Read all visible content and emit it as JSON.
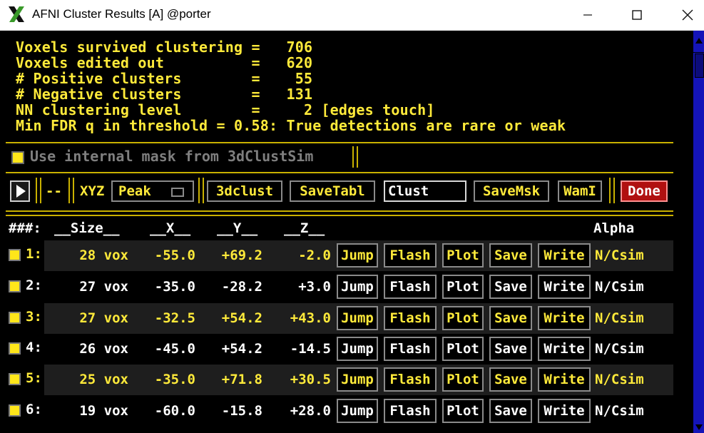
{
  "window": {
    "title": "AFNI Cluster Results [A] @porter",
    "controls": {
      "minimize": "─",
      "maximize": "☐",
      "close": "✕"
    }
  },
  "summary": [
    "Voxels survived clustering =   706",
    "Voxels edited out          =   620",
    "# Positive clusters        =    55",
    "# Negative clusters        =   131",
    "NN clustering level        =     2 [edges touch]",
    "Min FDR q in threshold = 0.58: True detections are rare or weak"
  ],
  "mask_option": {
    "label": "Use internal mask from 3dClustSim",
    "checked": true
  },
  "toolbar": {
    "play": "▶",
    "dashes": "--",
    "coord_label": "XYZ",
    "peak_label": "Peak",
    "clust_button": "3dclust",
    "savetabl_button": "SaveTabl",
    "prefix_value": "Clust",
    "savemsk_button": "SaveMsk",
    "wami_button": "WamI",
    "done_button": "Done"
  },
  "columns": {
    "index": "###:",
    "size": "__Size__",
    "x": "__X__",
    "y": "__Y__",
    "z": "__Z__",
    "alpha": "Alpha"
  },
  "row_buttons": {
    "jump": "Jump",
    "flash": "Flash",
    "plot": "Plot",
    "save": "Save",
    "write": "Write"
  },
  "clusters": [
    {
      "num": "1:",
      "size": "28 vox",
      "x": "-55.0",
      "y": "+69.2",
      "z": "-2.0",
      "alpha": "N/Csim",
      "color": "yellow"
    },
    {
      "num": "2:",
      "size": "27 vox",
      "x": "-35.0",
      "y": "-28.2",
      "z": "+3.0",
      "alpha": "N/Csim",
      "color": "white"
    },
    {
      "num": "3:",
      "size": "27 vox",
      "x": "-32.5",
      "y": "+54.2",
      "z": "+43.0",
      "alpha": "N/Csim",
      "color": "yellow"
    },
    {
      "num": "4:",
      "size": "26 vox",
      "x": "-45.0",
      "y": "+54.2",
      "z": "-14.5",
      "alpha": "N/Csim",
      "color": "white"
    },
    {
      "num": "5:",
      "size": "25 vox",
      "x": "-35.0",
      "y": "+71.8",
      "z": "+30.5",
      "alpha": "N/Csim",
      "color": "yellow"
    },
    {
      "num": "6:",
      "size": "19 vox",
      "x": "-60.0",
      "y": "-15.8",
      "z": "+28.0",
      "alpha": "N/Csim",
      "color": "white"
    }
  ],
  "colors": {
    "text_yellow": "#ffea3a",
    "separator": "#c9b100",
    "done_bg": "#b01010",
    "scrollbar": "#1414b8"
  }
}
